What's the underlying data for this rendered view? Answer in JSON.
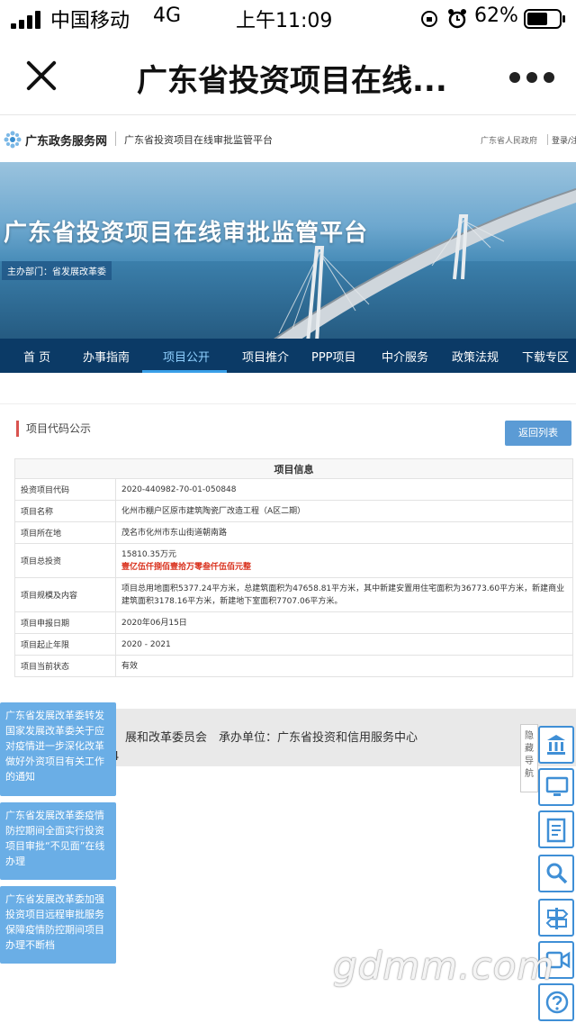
{
  "status_bar": {
    "carrier": "中国移动",
    "network": "4G",
    "time": "上午11:09",
    "battery": "62%"
  },
  "nav": {
    "title": "广东省投资项目在线..."
  },
  "site_header": {
    "logo_text": "广东政务服务网",
    "platform_name": "广东省投资项目在线审批监管平台",
    "gov_link": "广东省人民政府",
    "login": "登录/注"
  },
  "banner": {
    "headline": "广东省投资项目在线审批监管平台",
    "sponsor": "主办部门：省发展改革委"
  },
  "menu": {
    "items": [
      "首 页",
      "办事指南",
      "项目公开",
      "项目推介",
      "PPP项目",
      "中介服务",
      "政策法规",
      "下载专区"
    ],
    "active": "项目公开"
  },
  "content": {
    "section_title": "项目代码公示",
    "back_button": "返回列表",
    "table_header": "项目信息",
    "rows": [
      {
        "key": "投资项目代码",
        "value": "2020-440982-70-01-050848"
      },
      {
        "key": "项目名称",
        "value": "化州市棚户区原市建筑陶瓷厂改造工程（A区二期）"
      },
      {
        "key": "项目所在地",
        "value": "茂名市化州市东山街道朝南路"
      },
      {
        "key": "项目总投资",
        "value": "15810.35万元",
        "value2": "壹亿伍仟捌佰壹拾万零叁仟伍佰元整"
      },
      {
        "key": "项目规模及内容",
        "value": "项目总用地面积5377.24平方米，总建筑面积为47658.81平方米，其中新建安置用住宅面积为36773.60平方米，新建商业建筑面积3178.16平方米，新建地下室面积7707.06平方米。"
      },
      {
        "key": "项目申报日期",
        "value": "2020年06月15日"
      },
      {
        "key": "项目起止年限",
        "value": "2020 - 2021"
      },
      {
        "key": "项目当前状态",
        "value": "有效"
      }
    ]
  },
  "footer": {
    "line1": "展和改革委员会　承办单位：广东省投资和信用服务中心",
    "line2": "4"
  },
  "notices": [
    "广东省发展改革委转发国家发展改革委关于应对疫情进一步深化改革做好外资项目有关工作的通知",
    "广东省发展改革委疫情防控期间全面实行投资项目审批“不见面”在线办理",
    "广东省发展改革委加强投资项目远程审批服务保障疫情防控期间项目办理不断档"
  ],
  "side_toolbar": {
    "hide_label": "隐藏导航",
    "icons": [
      "bank-icon",
      "computer-icon",
      "document-icon",
      "search-icon",
      "signpost-icon",
      "video-icon",
      "help-icon"
    ]
  },
  "watermark": "gdmm.com",
  "colors": {
    "menu_bg": "#0b3a66",
    "accent_blue": "#5b9bd5",
    "notice_bg": "#6aaee6",
    "highlight_red": "#d9301c"
  }
}
